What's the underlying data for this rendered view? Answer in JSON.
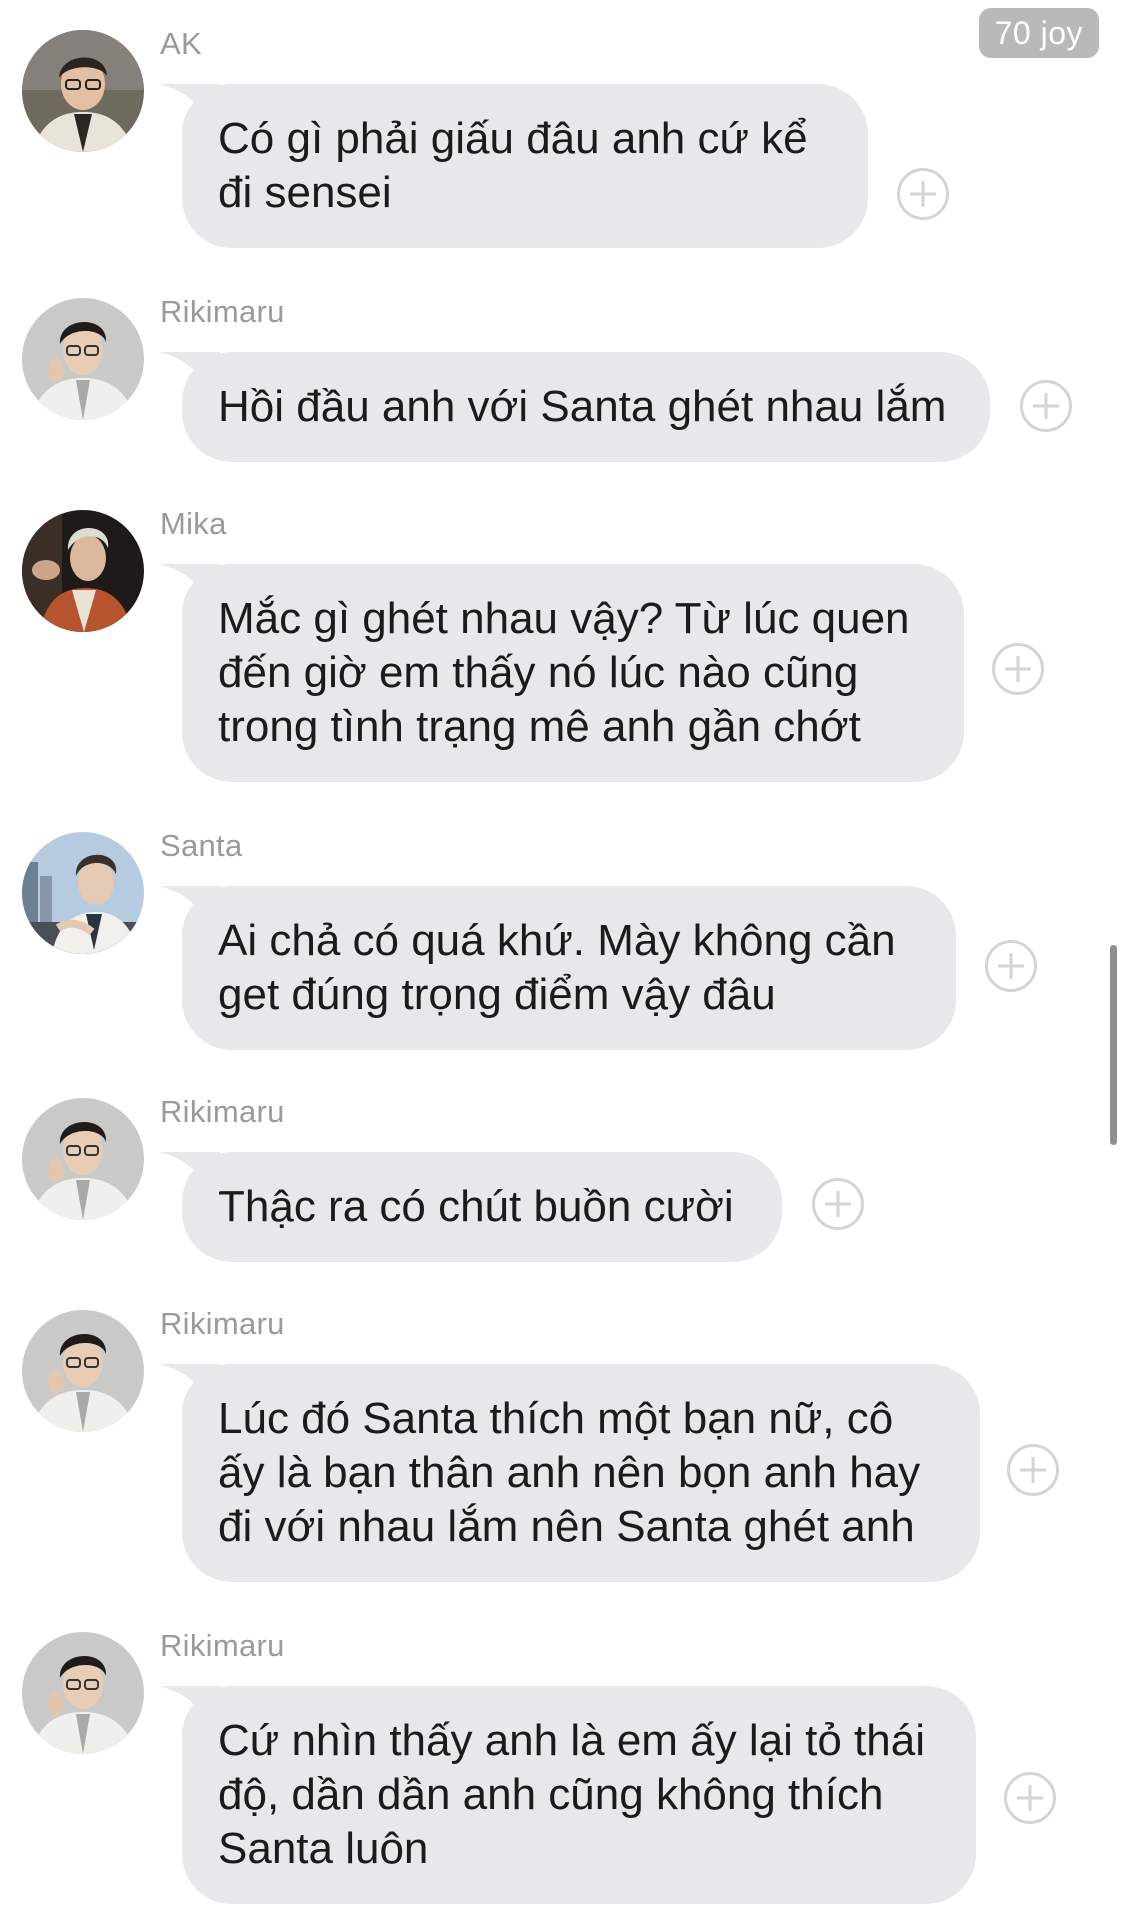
{
  "header": {
    "joy_badge": "70 joy"
  },
  "messages": [
    {
      "sender": "AK",
      "text": "Có gì phải giấu đâu anh cứ kể đi sensei",
      "avatar": "ak-avatar"
    },
    {
      "sender": "Rikimaru",
      "text": "Hồi đầu anh với Santa ghét nhau lắm",
      "avatar": "rikimaru-avatar"
    },
    {
      "sender": "Mika",
      "text": "Mắc gì ghét nhau vậy? Từ lúc quen đến giờ em thấy nó lúc nào cũng trong tình trạng mê anh gần chớt",
      "avatar": "mika-avatar"
    },
    {
      "sender": "Santa",
      "text": "Ai chả có quá khứ. Mày không cần get đúng trọng điểm vậy đâu",
      "avatar": "santa-avatar"
    },
    {
      "sender": "Rikimaru",
      "text": "Thậc ra có chút buồn cười",
      "avatar": "rikimaru-avatar"
    },
    {
      "sender": "Rikimaru",
      "text": "Lúc đó Santa thích một bạn nữ, cô ấy là bạn thân anh nên bọn anh hay đi với nhau lắm nên Santa ghét anh",
      "avatar": "rikimaru-avatar"
    },
    {
      "sender": "Rikimaru",
      "text": "Cứ nhìn thấy anh là em ấy lại tỏ thái độ, dần dần anh cũng không thích Santa luôn",
      "avatar": "rikimaru-avatar"
    }
  ]
}
